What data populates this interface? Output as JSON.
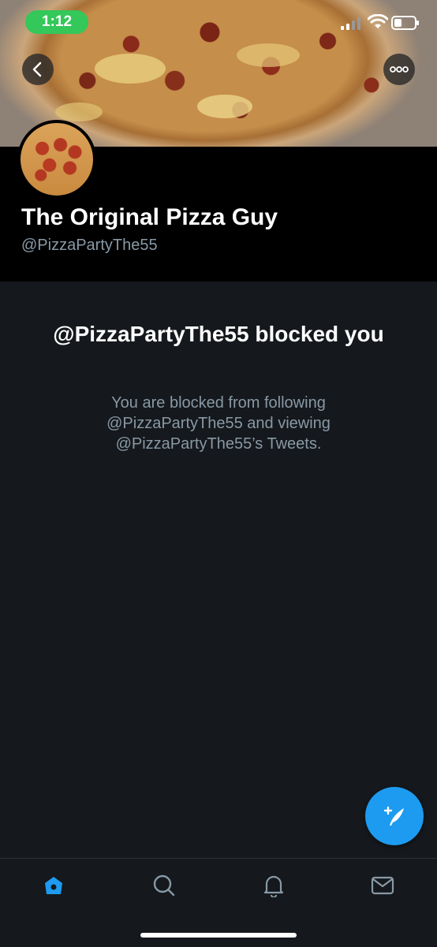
{
  "status_bar": {
    "time": "1:12"
  },
  "profile": {
    "display_name": "The Original Pizza Guy",
    "handle": "@PizzaPartyThe55"
  },
  "blocked": {
    "title": "@PizzaPartyThe55 blocked you",
    "message": "You are blocked from following @PizzaPartyThe55 and viewing @PizzaPartyThe55’s Tweets."
  },
  "icons": {
    "back": "chevron-left-icon",
    "more": "more-horizontal-icon",
    "compose": "compose-tweet-icon",
    "tabs": [
      "home-icon",
      "search-icon",
      "bell-icon",
      "mail-icon"
    ]
  },
  "colors": {
    "accent": "#1d9bf0",
    "time_pill": "#34c759",
    "background": "#15181c",
    "secondary_text": "#8899a6"
  }
}
